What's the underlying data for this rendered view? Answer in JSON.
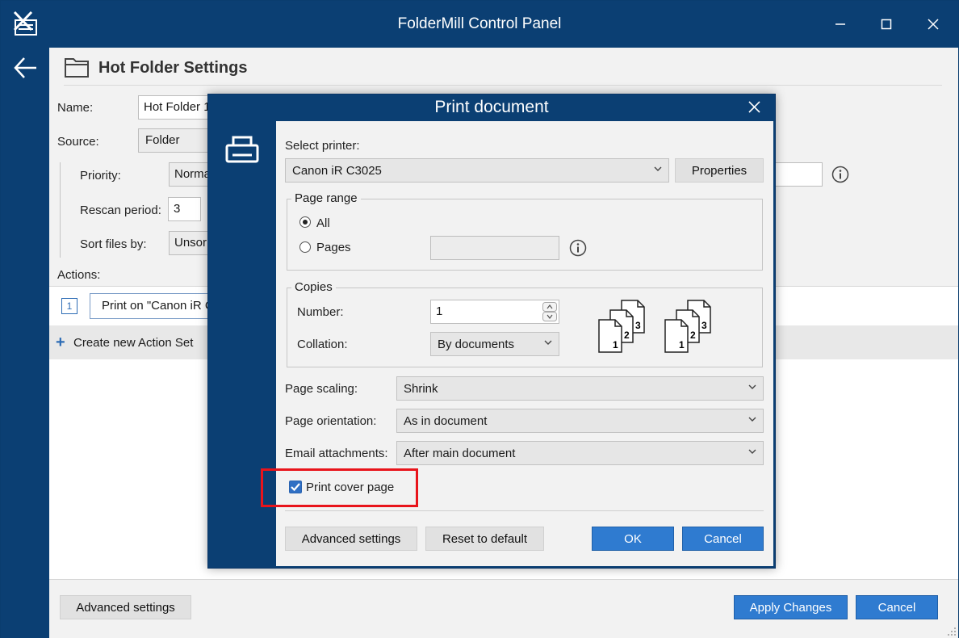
{
  "window": {
    "title": "FolderMill Control Panel"
  },
  "header": {
    "title": "Hot Folder Settings"
  },
  "form": {
    "name_label": "Name:",
    "name_value": "Hot Folder 1",
    "source_label": "Source:",
    "source_value": "Folder",
    "priority_label": "Priority:",
    "priority_value": "Norma",
    "rescan_label": "Rescan period:",
    "rescan_value": "3",
    "sort_label": "Sort files by:",
    "sort_value": "Unsor",
    "actions_label": "Actions:"
  },
  "actions": {
    "items": [
      {
        "index": "1",
        "label": "Print on \"Canon iR C"
      }
    ],
    "create_label": "Create new Action Set"
  },
  "bottom": {
    "advanced_label": "Advanced settings",
    "apply_label": "Apply Changes",
    "cancel_label": "Cancel"
  },
  "dialog": {
    "title": "Print document",
    "select_printer_label": "Select printer:",
    "printer_value": "Canon iR C3025",
    "properties_label": "Properties",
    "page_range": {
      "legend": "Page range",
      "all_label": "All",
      "pages_label": "Pages",
      "pages_value": "",
      "selected": "All"
    },
    "copies": {
      "legend": "Copies",
      "number_label": "Number:",
      "number_value": "1",
      "collation_label": "Collation:",
      "collation_value": "By documents",
      "icon_labels": [
        "1",
        "2",
        "3"
      ]
    },
    "scaling_label": "Page scaling:",
    "scaling_value": "Shrink",
    "orientation_label": "Page orientation:",
    "orientation_value": "As in document",
    "email_label": "Email attachments:",
    "email_value": "After main document",
    "cover_page_label": "Print cover page",
    "cover_page_checked": true,
    "advanced_label": "Advanced settings",
    "reset_label": "Reset to default",
    "ok_label": "OK",
    "cancel_label": "Cancel"
  },
  "colors": {
    "titlebar": "#0b3f73",
    "accent_button": "#2f7bd0",
    "highlight": "#e8141b"
  }
}
